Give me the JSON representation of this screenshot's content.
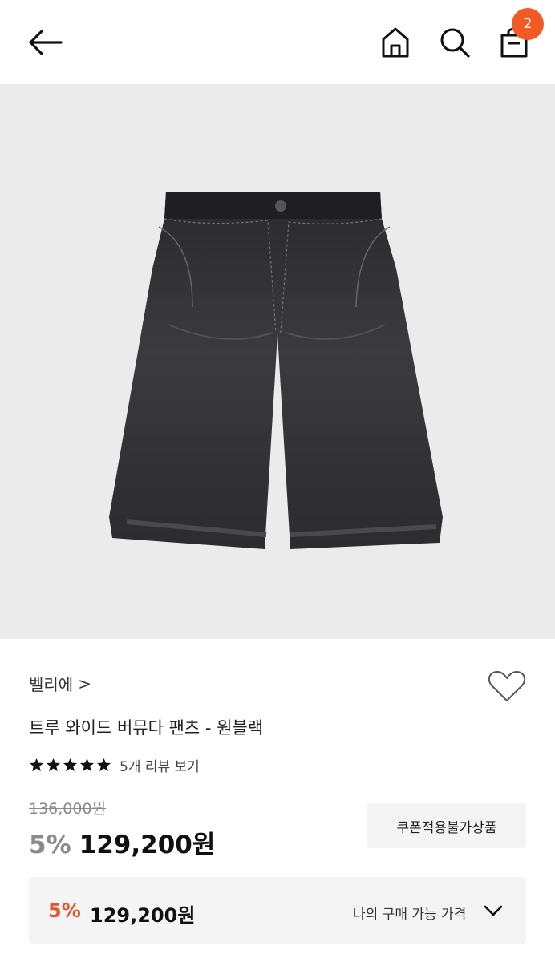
{
  "header": {
    "back_icon": "arrow-left-icon",
    "home_icon": "home-icon",
    "search_icon": "search-icon",
    "cart_icon": "shopping-bag-icon",
    "cart_count": "2",
    "badge_color": "#f15a24"
  },
  "product": {
    "image_alt_icon": "denim-shorts-image",
    "brand": "벨리에",
    "brand_chevron": ">",
    "title": "트루 와이드 버뮤다 팬츠 - 원블랙",
    "rating": 5,
    "review_link": "5개 리뷰 보기",
    "original_price": "136,000원",
    "discount": "5%",
    "price": "129,200원",
    "coupon_button": "쿠폰적용불가상품",
    "my_price": {
      "discount": "5%",
      "price": "129,200원",
      "label": "나의 구매 가능 가격",
      "accent": "#e4572e"
    }
  }
}
